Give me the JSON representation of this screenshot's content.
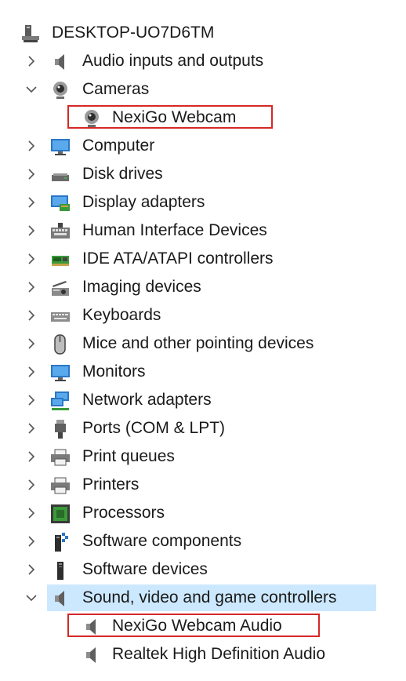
{
  "root": {
    "label": "DESKTOP-UO7D6TM",
    "icon": "computer-tower-icon"
  },
  "categories": [
    {
      "label": "Audio inputs and outputs",
      "icon": "speaker-icon",
      "expanded": false
    },
    {
      "label": "Cameras",
      "icon": "webcam-icon",
      "expanded": true,
      "children": [
        {
          "label": "NexiGo Webcam",
          "icon": "webcam-icon",
          "highlighted": true
        }
      ]
    },
    {
      "label": "Computer",
      "icon": "monitor-icon",
      "expanded": false
    },
    {
      "label": "Disk drives",
      "icon": "disk-drive-icon",
      "expanded": false
    },
    {
      "label": "Display adapters",
      "icon": "display-adapter-icon",
      "expanded": false
    },
    {
      "label": "Human Interface Devices",
      "icon": "hid-keyboard-icon",
      "expanded": false
    },
    {
      "label": "IDE ATA/ATAPI controllers",
      "icon": "ide-controller-icon",
      "expanded": false
    },
    {
      "label": "Imaging devices",
      "icon": "scanner-icon",
      "expanded": false
    },
    {
      "label": "Keyboards",
      "icon": "keyboard-icon",
      "expanded": false
    },
    {
      "label": "Mice and other pointing devices",
      "icon": "mouse-icon",
      "expanded": false
    },
    {
      "label": "Monitors",
      "icon": "monitor-icon",
      "expanded": false
    },
    {
      "label": "Network adapters",
      "icon": "network-adapter-icon",
      "expanded": false
    },
    {
      "label": "Ports (COM & LPT)",
      "icon": "port-connector-icon",
      "expanded": false
    },
    {
      "label": "Print queues",
      "icon": "printer-icon",
      "expanded": false
    },
    {
      "label": "Printers",
      "icon": "printer-icon",
      "expanded": false
    },
    {
      "label": "Processors",
      "icon": "processor-chip-icon",
      "expanded": false
    },
    {
      "label": "Software components",
      "icon": "software-component-icon",
      "expanded": false
    },
    {
      "label": "Software devices",
      "icon": "software-device-icon",
      "expanded": false
    },
    {
      "label": "Sound, video and game controllers",
      "icon": "speaker-icon",
      "expanded": true,
      "selected": true,
      "children": [
        {
          "label": "NexiGo Webcam Audio",
          "icon": "speaker-icon",
          "highlighted": true
        },
        {
          "label": "Realtek High Definition Audio",
          "icon": "speaker-icon",
          "highlighted": false
        }
      ]
    }
  ],
  "colors": {
    "selection": "#cce8ff",
    "highlight_border": "#d62828",
    "chevron": "#555555"
  }
}
